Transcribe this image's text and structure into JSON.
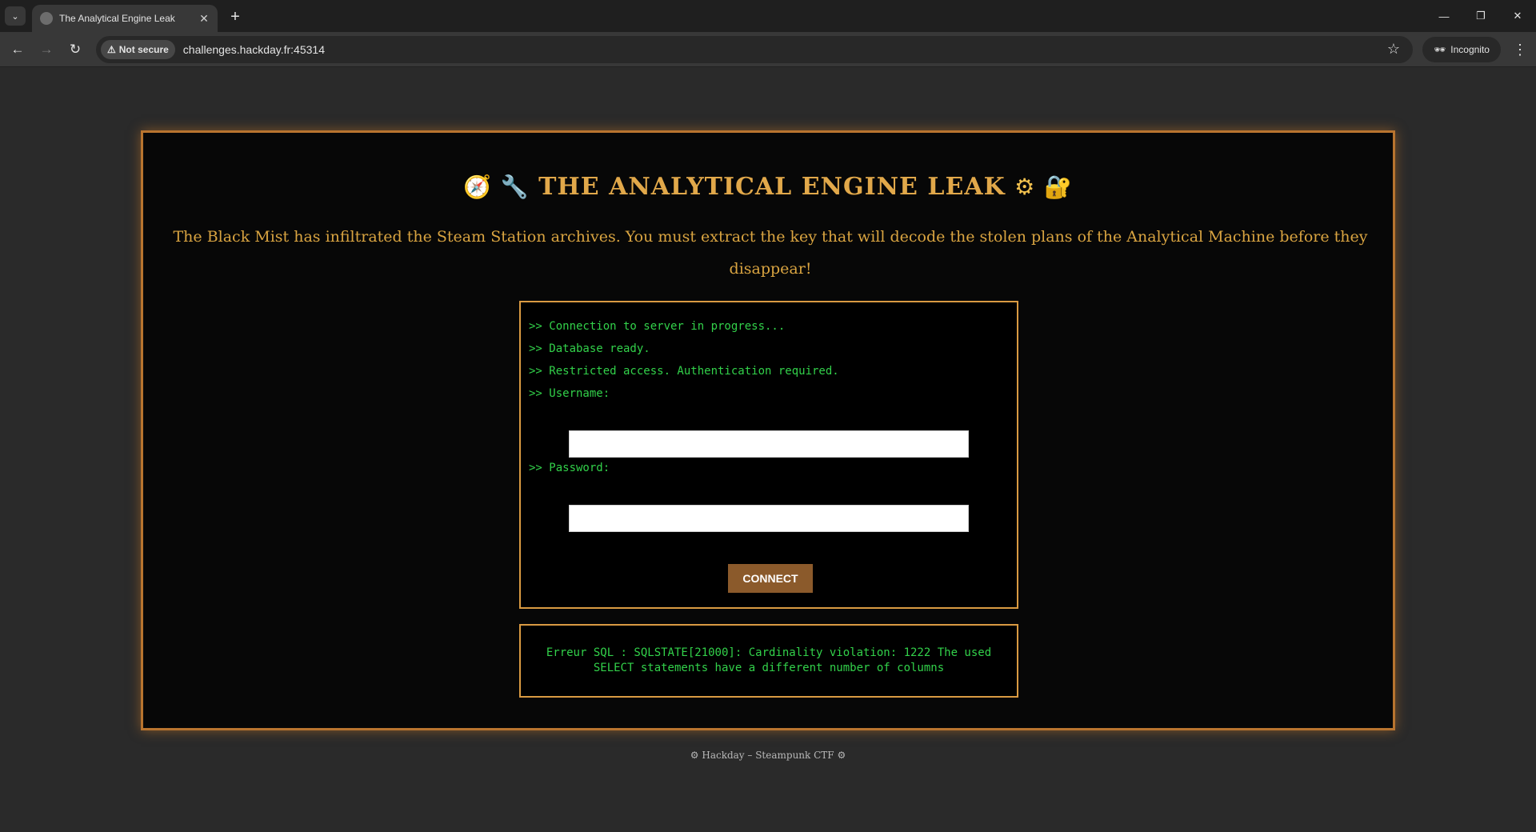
{
  "browser": {
    "tab_title": "The Analytical Engine Leak",
    "tab_close": "✕",
    "new_tab": "+",
    "security_label": "Not secure",
    "url": "challenges.hackday.fr:45314",
    "incognito_label": "Incognito",
    "icons": {
      "tab_list": "chevron-down-icon",
      "back": "arrow-left-icon",
      "forward": "arrow-right-icon",
      "reload": "reload-icon",
      "warning": "warning-icon",
      "bookmark": "star-icon",
      "incognito": "incognito-icon",
      "menu": "kebab-menu-icon",
      "minimize": "minimize-icon",
      "restore": "restore-icon",
      "close": "close-icon"
    }
  },
  "page": {
    "title_emoji_left": "🧭 🔧",
    "title": "THE ANALYTICAL ENGINE LEAK",
    "title_emoji_right": "⚙ 🔐",
    "description": "The Black Mist has infiltrated the Steam Station archives. You must extract the key that will decode the stolen plans of the Analytical Machine before they disappear!",
    "terminal": {
      "line1": ">> Connection to server in progress...",
      "line2": ">> Database ready.",
      "line3": ">> Restricted access. Authentication required.",
      "username_label": ">> Username:",
      "username_value": "",
      "password_label": ">> Password:",
      "password_value": "",
      "connect_label": "CONNECT"
    },
    "error": "Erreur SQL : SQLSTATE[21000]: Cardinality violation: 1222 The used SELECT statements have a different number of columns",
    "footer": "⚙ Hackday – Steampunk CTF ⚙"
  },
  "colors": {
    "panel_border": "#b8742f",
    "title": "#e1a84a",
    "terminal_text": "#32d14a",
    "button": "#8b5a2b"
  }
}
